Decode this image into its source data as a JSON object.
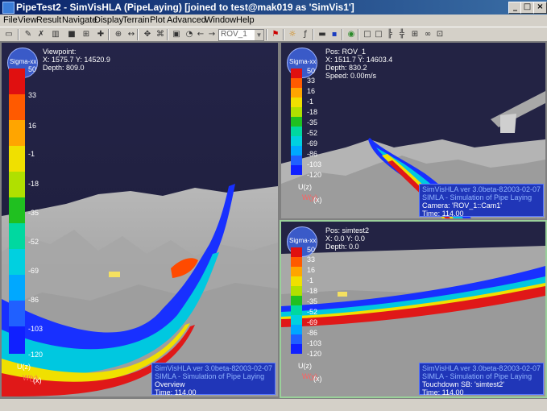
{
  "window": {
    "title": "PipeTest2 - SimVisHLA (PipeLaying)  [joined to test@mak019 as 'SimVis1']",
    "controls": [
      "_",
      "□",
      "×"
    ]
  },
  "menu": [
    "File",
    "View",
    "Result",
    "Navigate",
    "Display",
    "Terrain",
    "Plot",
    "Advanced",
    "Window",
    "Help"
  ],
  "toolbar": {
    "combo_value": "ROV_1",
    "icons": [
      "open-icon",
      "tools-icon",
      "wrench-icon",
      "bars-icon",
      "cube-icon",
      "move-icon",
      "nav-icon",
      "zoom-icon",
      "pan-icon",
      "select-icon",
      "camera-icon",
      "car-icon",
      "back-icon",
      "forward-icon",
      "pin-icon",
      "sun-icon",
      "fx-icon",
      "flag-icon",
      "save-icon",
      "globe-icon",
      "layout1-icon",
      "layout2-icon",
      "layout3-icon",
      "layout4-icon",
      "glasses-icon",
      "grid-icon"
    ]
  },
  "scale_labels": [
    "50",
    "33",
    "16",
    "-1",
    "-18",
    "-35",
    "-52",
    "-69",
    "-86",
    "-103",
    "-120"
  ],
  "scale_colors": [
    "#e01010",
    "#ff5a00",
    "#ffa500",
    "#f0e000",
    "#b0e000",
    "#20c020",
    "#00d8a0",
    "#00d0e0",
    "#00a8ff",
    "#2060ff",
    "#1020ff"
  ],
  "compass_label": "Sigma-xx",
  "axis_labels": {
    "z": "U(z)",
    "y": "W(y)",
    "x": "(x)"
  },
  "views": {
    "main": {
      "lines": [
        "Viewpoint:",
        "X: 1575.7   Y: 14520.9",
        "Depth: 809.0"
      ],
      "info": {
        "app": "SimVisHLA ver 3.0beta-8",
        "date": "2003-02-07",
        "sim": "SIMLA - Simulation of Pipe Laying",
        "camera": "Overview",
        "time": "Time: 114.00"
      }
    },
    "top_right": {
      "lines": [
        "Pos: ROV_1",
        "X: 1511.7   Y: 14603.4",
        "Depth: 830.2",
        "Speed: 0.00m/s"
      ],
      "info": {
        "app": "SimVisHLA ver 3.0beta-8",
        "date": "2003-02-07",
        "sim": "SIMLA - Simulation of Pipe Laying",
        "camera": "Camera: 'ROV_1::Cam1'",
        "time": "Time: 114.00"
      }
    },
    "bottom_right": {
      "lines": [
        "Pos: simtest2",
        "X: 0.0   Y: 0.0",
        "Depth: 0.0"
      ],
      "info": {
        "app": "SimVisHLA ver 3.0beta-8",
        "date": "2003-02-07",
        "sim": "SIMLA - Simulation of Pipe Laying",
        "camera": "Touchdown SB: 'simtest2'",
        "time": "Time: 114.00"
      }
    }
  },
  "colors": {
    "sky": "#1e1e3e",
    "terrain": "#9a9a9a",
    "info_bg": "#2036b8",
    "title_blue": "#0a246a"
  }
}
